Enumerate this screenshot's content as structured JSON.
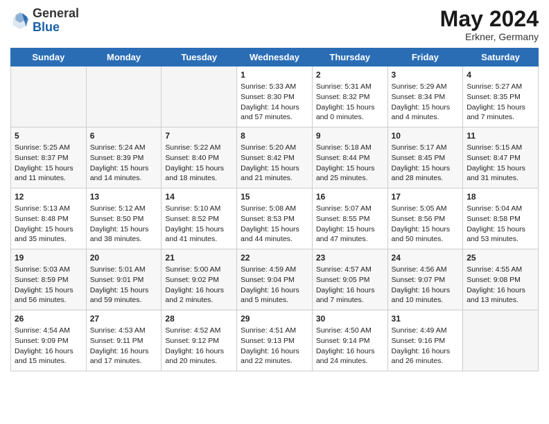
{
  "header": {
    "logo_general": "General",
    "logo_blue": "Blue",
    "month_year": "May 2024",
    "location": "Erkner, Germany"
  },
  "weekdays": [
    "Sunday",
    "Monday",
    "Tuesday",
    "Wednesday",
    "Thursday",
    "Friday",
    "Saturday"
  ],
  "weeks": [
    [
      {
        "day": "",
        "info": "",
        "empty": true
      },
      {
        "day": "",
        "info": "",
        "empty": true
      },
      {
        "day": "",
        "info": "",
        "empty": true
      },
      {
        "day": "1",
        "info": "Sunrise: 5:33 AM\nSunset: 8:30 PM\nDaylight: 14 hours\nand 57 minutes."
      },
      {
        "day": "2",
        "info": "Sunrise: 5:31 AM\nSunset: 8:32 PM\nDaylight: 15 hours\nand 0 minutes."
      },
      {
        "day": "3",
        "info": "Sunrise: 5:29 AM\nSunset: 8:34 PM\nDaylight: 15 hours\nand 4 minutes."
      },
      {
        "day": "4",
        "info": "Sunrise: 5:27 AM\nSunset: 8:35 PM\nDaylight: 15 hours\nand 7 minutes."
      }
    ],
    [
      {
        "day": "5",
        "info": "Sunrise: 5:25 AM\nSunset: 8:37 PM\nDaylight: 15 hours\nand 11 minutes."
      },
      {
        "day": "6",
        "info": "Sunrise: 5:24 AM\nSunset: 8:39 PM\nDaylight: 15 hours\nand 14 minutes."
      },
      {
        "day": "7",
        "info": "Sunrise: 5:22 AM\nSunset: 8:40 PM\nDaylight: 15 hours\nand 18 minutes."
      },
      {
        "day": "8",
        "info": "Sunrise: 5:20 AM\nSunset: 8:42 PM\nDaylight: 15 hours\nand 21 minutes."
      },
      {
        "day": "9",
        "info": "Sunrise: 5:18 AM\nSunset: 8:44 PM\nDaylight: 15 hours\nand 25 minutes."
      },
      {
        "day": "10",
        "info": "Sunrise: 5:17 AM\nSunset: 8:45 PM\nDaylight: 15 hours\nand 28 minutes."
      },
      {
        "day": "11",
        "info": "Sunrise: 5:15 AM\nSunset: 8:47 PM\nDaylight: 15 hours\nand 31 minutes."
      }
    ],
    [
      {
        "day": "12",
        "info": "Sunrise: 5:13 AM\nSunset: 8:48 PM\nDaylight: 15 hours\nand 35 minutes."
      },
      {
        "day": "13",
        "info": "Sunrise: 5:12 AM\nSunset: 8:50 PM\nDaylight: 15 hours\nand 38 minutes."
      },
      {
        "day": "14",
        "info": "Sunrise: 5:10 AM\nSunset: 8:52 PM\nDaylight: 15 hours\nand 41 minutes."
      },
      {
        "day": "15",
        "info": "Sunrise: 5:08 AM\nSunset: 8:53 PM\nDaylight: 15 hours\nand 44 minutes."
      },
      {
        "day": "16",
        "info": "Sunrise: 5:07 AM\nSunset: 8:55 PM\nDaylight: 15 hours\nand 47 minutes."
      },
      {
        "day": "17",
        "info": "Sunrise: 5:05 AM\nSunset: 8:56 PM\nDaylight: 15 hours\nand 50 minutes."
      },
      {
        "day": "18",
        "info": "Sunrise: 5:04 AM\nSunset: 8:58 PM\nDaylight: 15 hours\nand 53 minutes."
      }
    ],
    [
      {
        "day": "19",
        "info": "Sunrise: 5:03 AM\nSunset: 8:59 PM\nDaylight: 15 hours\nand 56 minutes."
      },
      {
        "day": "20",
        "info": "Sunrise: 5:01 AM\nSunset: 9:01 PM\nDaylight: 15 hours\nand 59 minutes."
      },
      {
        "day": "21",
        "info": "Sunrise: 5:00 AM\nSunset: 9:02 PM\nDaylight: 16 hours\nand 2 minutes."
      },
      {
        "day": "22",
        "info": "Sunrise: 4:59 AM\nSunset: 9:04 PM\nDaylight: 16 hours\nand 5 minutes."
      },
      {
        "day": "23",
        "info": "Sunrise: 4:57 AM\nSunset: 9:05 PM\nDaylight: 16 hours\nand 7 minutes."
      },
      {
        "day": "24",
        "info": "Sunrise: 4:56 AM\nSunset: 9:07 PM\nDaylight: 16 hours\nand 10 minutes."
      },
      {
        "day": "25",
        "info": "Sunrise: 4:55 AM\nSunset: 9:08 PM\nDaylight: 16 hours\nand 13 minutes."
      }
    ],
    [
      {
        "day": "26",
        "info": "Sunrise: 4:54 AM\nSunset: 9:09 PM\nDaylight: 16 hours\nand 15 minutes."
      },
      {
        "day": "27",
        "info": "Sunrise: 4:53 AM\nSunset: 9:11 PM\nDaylight: 16 hours\nand 17 minutes."
      },
      {
        "day": "28",
        "info": "Sunrise: 4:52 AM\nSunset: 9:12 PM\nDaylight: 16 hours\nand 20 minutes."
      },
      {
        "day": "29",
        "info": "Sunrise: 4:51 AM\nSunset: 9:13 PM\nDaylight: 16 hours\nand 22 minutes."
      },
      {
        "day": "30",
        "info": "Sunrise: 4:50 AM\nSunset: 9:14 PM\nDaylight: 16 hours\nand 24 minutes."
      },
      {
        "day": "31",
        "info": "Sunrise: 4:49 AM\nSunset: 9:16 PM\nDaylight: 16 hours\nand 26 minutes."
      },
      {
        "day": "",
        "info": "",
        "empty": true
      }
    ]
  ]
}
